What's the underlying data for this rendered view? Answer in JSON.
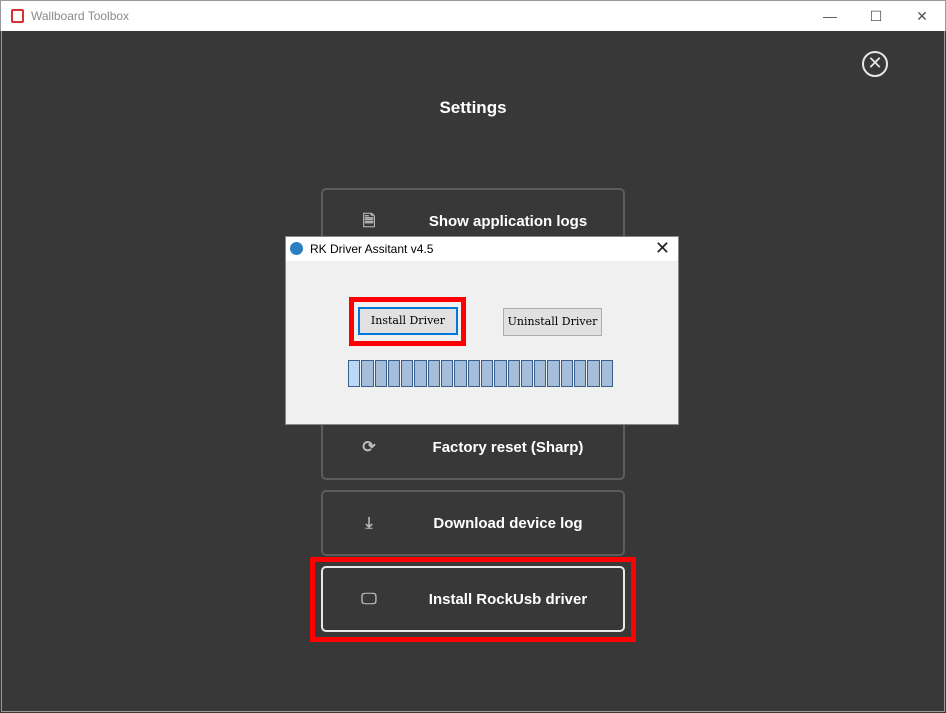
{
  "window": {
    "title": "Wallboard Toolbox",
    "minimize": "—",
    "maximize": "☐",
    "close": "✕"
  },
  "main": {
    "heading": "Settings",
    "close_icon": "✕",
    "buttons": [
      {
        "label": "Show application logs",
        "icon": "log-file-icon"
      },
      {
        "label": "",
        "icon": ""
      },
      {
        "label": "",
        "icon": ""
      },
      {
        "label": "Factory reset (Sharp)",
        "icon": "refresh-icon"
      },
      {
        "label": "Download device log",
        "icon": "download-icon"
      },
      {
        "label": "Install RockUsb driver",
        "icon": "monitor-icon"
      }
    ]
  },
  "dialog": {
    "title": "RK Driver Assitant v4.5",
    "close": "✕",
    "install_label": "Install Driver",
    "uninstall_label": "Uninstall Driver",
    "progress_segments": 20,
    "progress_highlight_color": "#bcd8f7"
  },
  "highlight_color": "#ff0000"
}
